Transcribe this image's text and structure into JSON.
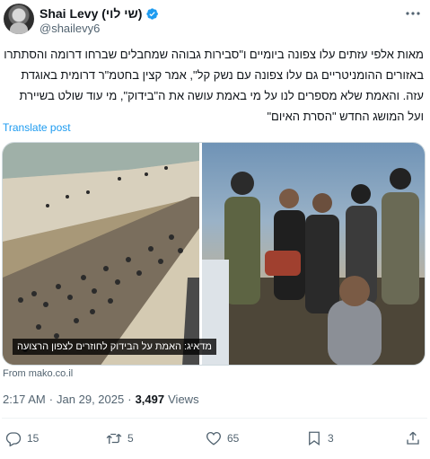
{
  "author": {
    "display_name": "Shai Levy (שי לוי)",
    "handle": "@shailevy6",
    "verified": true
  },
  "tweet": {
    "text": "מאות אלפי עזתים עלו צפונה ביומיים ו\"סבירות גבוהה שמחבלים שברחו דרומה והסתתרו באזורים ההומניטריים גם עלו צפונה עם נשק קל\", אמר קצין בחטמ\"ר דרומית באוגדת עזה. והאמת שלא מספרים לנו על מי באמת עושה את ה\"בידוק\", מי עוד שולט בשיירת ועל המושג החדש \"הסרת האיום\"",
    "translate_label": "Translate post",
    "media_caption": "מדאיג: האמת על הבידוק לחוזרים לצפון הרצועה",
    "source": "From mako.co.il",
    "time": "2:17 AM",
    "date": "Jan 29, 2025",
    "views_count": "3,497",
    "views_label": "Views"
  },
  "actions": {
    "replies": "15",
    "reposts": "5",
    "likes": "65",
    "bookmarks": "3"
  },
  "icons": {
    "verified": "verified-badge-icon",
    "more": "more-icon",
    "reply": "reply-icon",
    "repost": "repost-icon",
    "like": "heart-icon",
    "bookmark": "bookmark-icon",
    "share": "share-icon"
  },
  "colors": {
    "accent": "#1d9bf0",
    "text": "#0f1419",
    "muted": "#536471"
  }
}
